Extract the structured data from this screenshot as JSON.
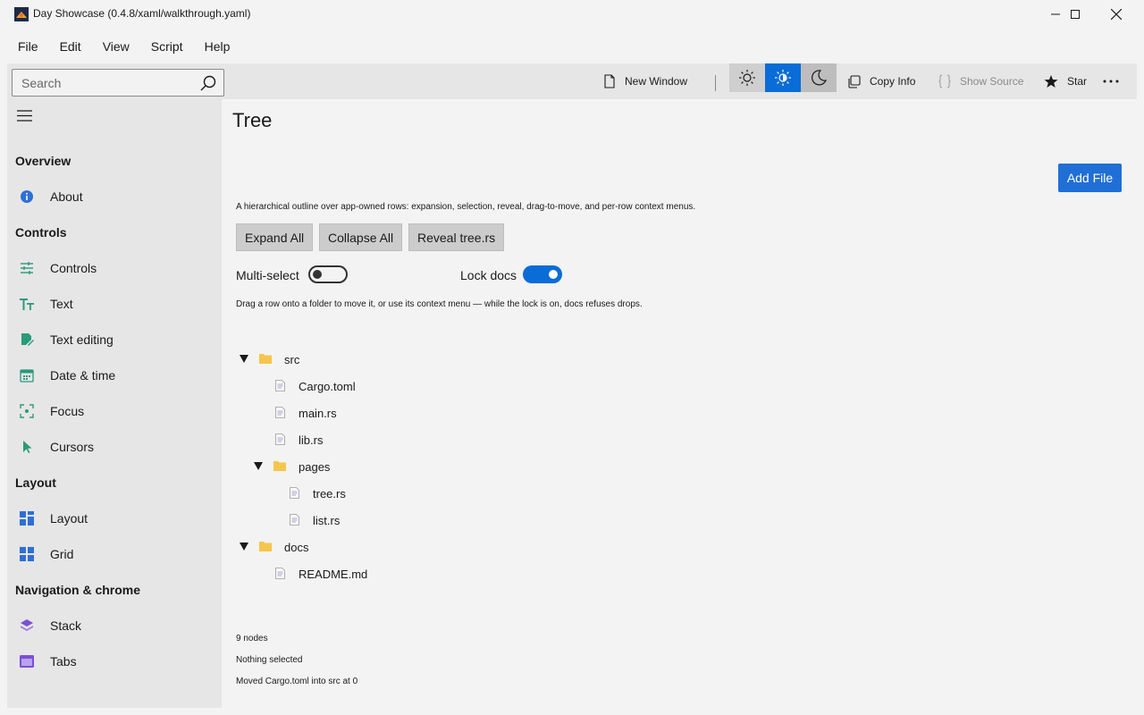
{
  "window": {
    "title": "Day Showcase (0.4.8/xaml/walkthrough.yaml)"
  },
  "menu": [
    "File",
    "Edit",
    "View",
    "Script",
    "Help"
  ],
  "toolbar": {
    "search_placeholder": "Search",
    "new_window": "New Window",
    "copy_info": "Copy Info",
    "show_source": "Show Source",
    "star": "Star",
    "theme_selected": "auto",
    "accent_color": "#0a6cd6"
  },
  "sidebar": {
    "sections": [
      {
        "title": "Overview",
        "items": [
          {
            "label": "About",
            "icon": "info-icon"
          }
        ]
      },
      {
        "title": "Controls",
        "items": [
          {
            "label": "Controls",
            "icon": "sliders-icon"
          },
          {
            "label": "Text",
            "icon": "text-icon"
          },
          {
            "label": "Text editing",
            "icon": "edit-icon"
          },
          {
            "label": "Date & time",
            "icon": "calendar-icon"
          },
          {
            "label": "Focus",
            "icon": "focus-icon"
          },
          {
            "label": "Cursors",
            "icon": "cursor-icon"
          }
        ]
      },
      {
        "title": "Layout",
        "items": [
          {
            "label": "Layout",
            "icon": "layout-icon"
          },
          {
            "label": "Grid",
            "icon": "grid-icon"
          }
        ]
      },
      {
        "title": "Navigation & chrome",
        "items": [
          {
            "label": "Stack",
            "icon": "stack-icon"
          },
          {
            "label": "Tabs",
            "icon": "tabs-icon"
          }
        ]
      }
    ]
  },
  "main": {
    "title": "Tree",
    "add_file": "Add File",
    "description": "A hierarchical outline over app-owned rows: expansion, selection, reveal, drag-to-move, and per-row context menus.",
    "buttons": {
      "expand_all": "Expand All",
      "collapse_all": "Collapse All",
      "reveal": "Reveal tree.rs"
    },
    "multi_select": {
      "label": "Multi-select",
      "on": false
    },
    "lock_docs": {
      "label": "Lock docs",
      "on": true
    },
    "hint": "Drag a row onto a folder to move it, or use its context menu — while the lock is on, docs refuses drops.",
    "tree": [
      {
        "label": "src",
        "type": "folder",
        "depth": 0,
        "expanded": true
      },
      {
        "label": "Cargo.toml",
        "type": "file",
        "depth": 1
      },
      {
        "label": "main.rs",
        "type": "file",
        "depth": 1
      },
      {
        "label": "lib.rs",
        "type": "file",
        "depth": 1
      },
      {
        "label": "pages",
        "type": "folder",
        "depth": 1,
        "expanded": true
      },
      {
        "label": "tree.rs",
        "type": "file",
        "depth": 2
      },
      {
        "label": "list.rs",
        "type": "file",
        "depth": 2
      },
      {
        "label": "docs",
        "type": "folder",
        "depth": 0,
        "expanded": true
      },
      {
        "label": "README.md",
        "type": "file",
        "depth": 1
      }
    ],
    "status": {
      "nodes": "9 nodes",
      "selection": "Nothing selected",
      "last_action": "Moved Cargo.toml into src at 0"
    }
  }
}
